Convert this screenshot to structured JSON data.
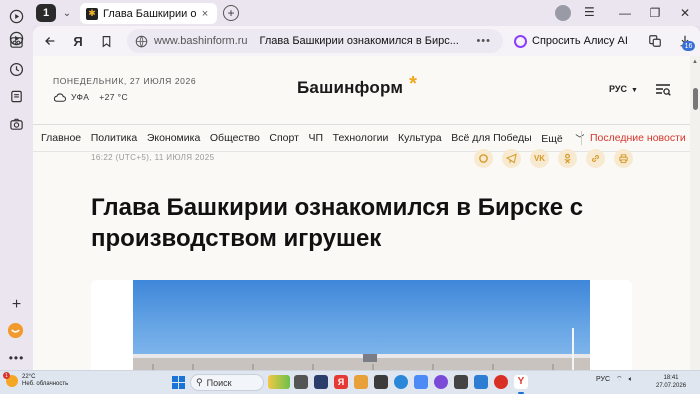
{
  "browser": {
    "tab_count": "1",
    "tab_title": "Глава Башкирии ознакомился в Бирске с производством игрушек",
    "url_domain": "www.bashinform.ru",
    "url_page_title": "Глава Башкирии ознакомился в Бирс...",
    "url_more": "•••",
    "alice_label": "Спросить Алису AI",
    "notification_badge": "16",
    "tab_close": "×",
    "new_tab": "+"
  },
  "site": {
    "date": "ПОНЕДЕЛЬНИК, 27 ИЮЛЯ 2026",
    "city": "УФА",
    "temperature": "+27 °С",
    "logo_text": "Башинформ",
    "logo_star": "*",
    "language": "РУС",
    "nav": [
      "Главное",
      "Политика",
      "Экономика",
      "Общество",
      "Спорт",
      "ЧП",
      "Технологии",
      "Культура",
      "Всё для Победы",
      "Ещё"
    ],
    "latest_news": "Последние новости"
  },
  "article": {
    "meta": "16:22 (UTC+5), 11 ИЮЛЯ 2025",
    "headline": "Глава Башкирии ознакомился в Бирске с производством игрушек",
    "share_icons": [
      "max-icon",
      "telegram-icon",
      "vk-icon",
      "ok-icon",
      "link-icon",
      "print-icon"
    ]
  },
  "taskbar": {
    "weather_temp": "22°C",
    "weather_desc": "Неб. облачность",
    "weather_notif": "1",
    "search_label": "Поиск",
    "language": "РУС",
    "time": "18:41",
    "date": "27.07.2026"
  },
  "colors": {
    "accent_red": "#d6352c",
    "logo_star": "#f0a81e",
    "share_bg": "#f7ead0",
    "alice_purple": "#8a3ffc"
  }
}
